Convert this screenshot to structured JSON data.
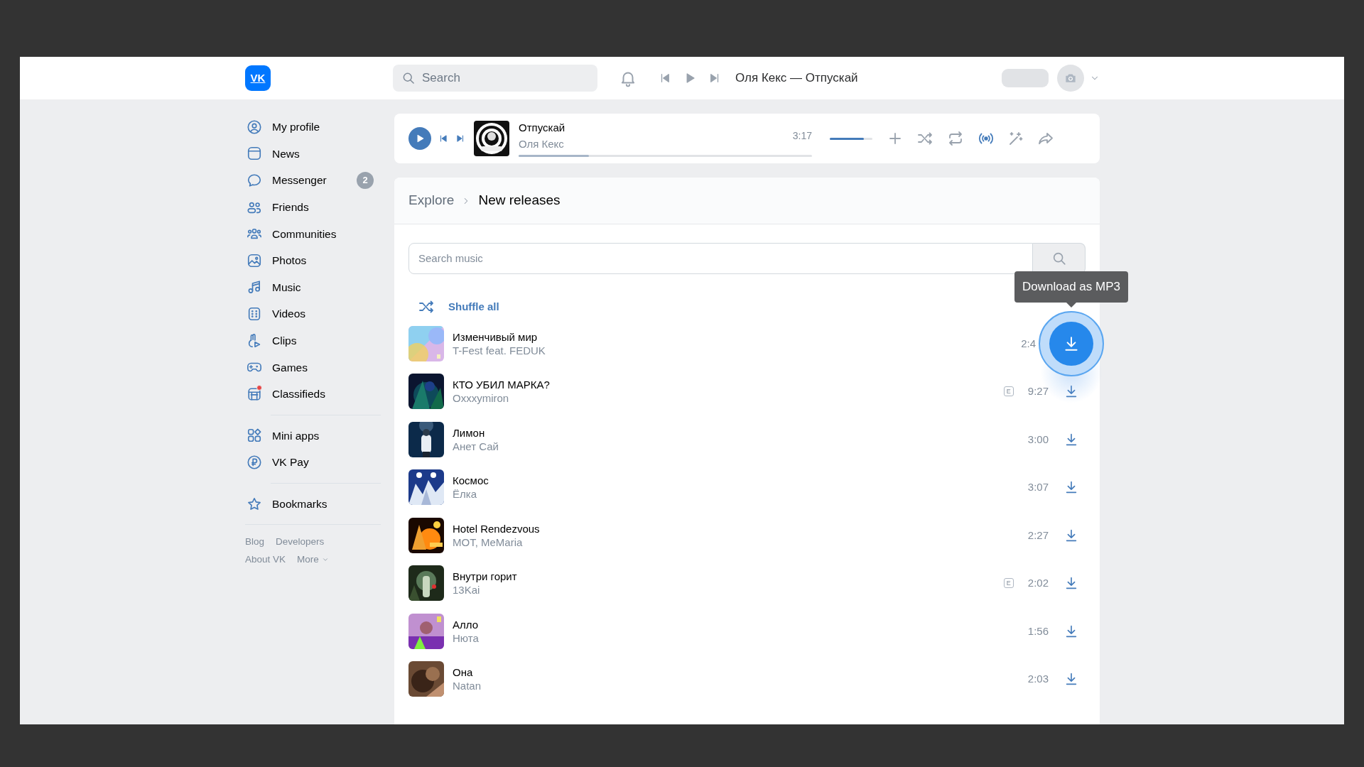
{
  "header": {
    "logo": "VK",
    "search": {
      "placeholder": "Search"
    },
    "now_playing": "Оля Кекс — Отпускай"
  },
  "sidebar": {
    "sections": [
      {
        "items": [
          {
            "label": "My profile"
          },
          {
            "label": "News"
          },
          {
            "label": "Messenger",
            "badge": "2"
          },
          {
            "label": "Friends"
          },
          {
            "label": "Communities"
          },
          {
            "label": "Photos"
          },
          {
            "label": "Music"
          },
          {
            "label": "Videos"
          },
          {
            "label": "Clips"
          },
          {
            "label": "Games"
          },
          {
            "label": "Classifieds",
            "notification": true
          }
        ]
      },
      {
        "items": [
          {
            "label": "Mini apps"
          },
          {
            "label": "VK Pay"
          }
        ]
      },
      {
        "items": [
          {
            "label": "Bookmarks"
          }
        ]
      }
    ],
    "footer": [
      "Blog",
      "Developers",
      "About VK",
      "More"
    ]
  },
  "player": {
    "title": "Отпускай",
    "artist": "Оля Кекс",
    "time": "3:17",
    "progress": {
      "level": 0.24
    },
    "volume": {
      "level": 0.8
    },
    "broadcast": {
      "on": true
    }
  },
  "breadcrumb": [
    {
      "label": "Explore",
      "current": false
    },
    {
      "label": "New releases",
      "current": true
    }
  ],
  "music_search": {
    "placeholder": "Search music"
  },
  "shuffle_all": "Shuffle all",
  "tooltip": "Download as MP3",
  "tracks": [
    {
      "title": "Изменчивый мир",
      "artist": "T-Fest feat. FEDUK",
      "duration": "2:4",
      "hovered": true
    },
    {
      "title": "КТО УБИЛ МАРКА?",
      "artist": "Oxxxymiron",
      "badge": "E",
      "duration": "9:27",
      "hovered": false
    },
    {
      "title": "Лимон",
      "artist": "Анет Сай",
      "duration": "3:00",
      "hovered": false
    },
    {
      "title": "Космос",
      "artist": "Ёлка",
      "duration": "3:07",
      "hovered": false
    },
    {
      "title": "Hotel Rendezvous",
      "artist": "MOT, MeMaria",
      "duration": "2:27",
      "hovered": false
    },
    {
      "title": "Внутри горит",
      "artist": "13Kai",
      "badge": "E",
      "duration": "2:02",
      "hovered": false
    },
    {
      "title": "Алло",
      "artist": "Нюта",
      "duration": "1:56",
      "hovered": false
    },
    {
      "title": "Она",
      "artist": "Natan",
      "duration": "2:03",
      "hovered": false
    }
  ]
}
